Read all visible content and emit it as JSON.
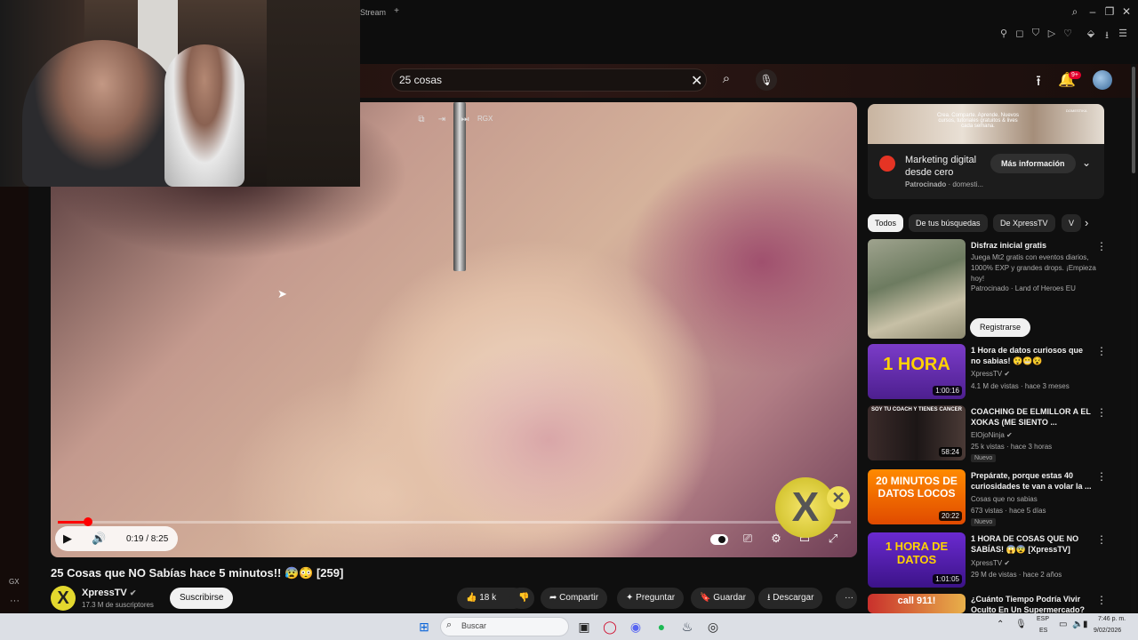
{
  "browser": {
    "tab_label": "Stream",
    "new_tab": "+",
    "window_controls": [
      "search-icon",
      "minimize-icon",
      "restore-icon",
      "close-icon"
    ],
    "extension_icons": [
      "pin-icon",
      "bookmark-icon",
      "shield-icon",
      "play-icon",
      "heart-icon",
      "extension-icon",
      "download-icon",
      "menu-icon",
      "more-icon"
    ]
  },
  "header": {
    "search_value": "25 cosas",
    "notification_badge": "9+"
  },
  "left_bar": {
    "gx_label": "GX",
    "more": "···"
  },
  "player": {
    "top_controls_label": "RGX",
    "current_time": "0:19",
    "duration": "8:25",
    "time_display": "0:19 / 8:25",
    "progress_fraction": 0.0376,
    "logo_glyph": "X"
  },
  "video": {
    "title": "25 Cosas que NO Sabías hace 5 minutos!! 😰😳 [259]",
    "channel": "XpressTV",
    "channel_logo": "X",
    "subscribers": "17.3 M de suscriptores",
    "subscribe_label": "Suscribirse",
    "likes": "18 k",
    "share_label": "Compartir",
    "ask_label": "Preguntar",
    "save_label": "Guardar",
    "download_label": "Descargar",
    "more": "···"
  },
  "ad": {
    "image_text": "Crea. Comparte. Aprende. Nuevos cursos, tutoriales gratuitos & lives cada semana.",
    "image_brand": "DOMESTIKA",
    "title": "Marketing digital desde cero",
    "sponsored": "Patrocinado",
    "advertiser": "domesti...",
    "sponsored_line": "Patrocinado · domesti...",
    "cta": "Más información"
  },
  "chips": [
    "Todos",
    "De tus búsquedas",
    "De XpressTV",
    "V"
  ],
  "recommendations": [
    {
      "title": "Disfraz inicial gratis",
      "description": "Juega Mt2 gratis con eventos diarios, 1000% EXP y grandes drops. ¡Empieza hoy!",
      "channel": "Patrocinado · Land of Heroes EU",
      "cta": "Registrarse"
    },
    {
      "title": "1 Hora de datos curiosos que no sabias! 😲😬😵",
      "channel": "XpressTV",
      "meta": "4.1 M de vistas · hace 3 meses",
      "duration": "1:00:16",
      "thumb_text": "1 HORA"
    },
    {
      "title": "COACHING DE ELMILLOR A EL XOKAS (ME SIENTO ...",
      "channel": "ElOjoNinja",
      "meta": "25 k vistas · hace 3 horas",
      "duration": "58:24",
      "badge": "Nuevo",
      "thumb_text": "SOY TU COACH Y TIENES CANCER"
    },
    {
      "title": "Prepárate, porque estas 40 curiosidades te van a volar la ...",
      "channel": "Cosas que no sabias",
      "meta": "673 vistas · hace 5 días",
      "duration": "20:22",
      "badge": "Nuevo",
      "thumb_text": "20 MINUTOS DE DATOS LOCOS"
    },
    {
      "title": "1 HORA DE COSAS QUE NO SABÍAS! 😱😨 [XpressTV]",
      "channel": "XpressTV",
      "meta": "29 M de vistas · hace 2 años",
      "duration": "1:01:05",
      "thumb_text": "1 HORA DE DATOS"
    },
    {
      "title": "¿Cuánto Tiempo Podría Vivir Oculto En Un Supermercado?",
      "thumb_text": "call 911!"
    }
  ],
  "taskbar": {
    "search_placeholder": "Buscar",
    "lang_top": "ESP",
    "lang_bottom": "ES",
    "time": "7:46 p. m.",
    "date": "9/02/2026"
  },
  "colors": {
    "accent_red": "#ff0000",
    "logo_yellow": "#e3d82e",
    "notification_red": "#e1002d"
  }
}
